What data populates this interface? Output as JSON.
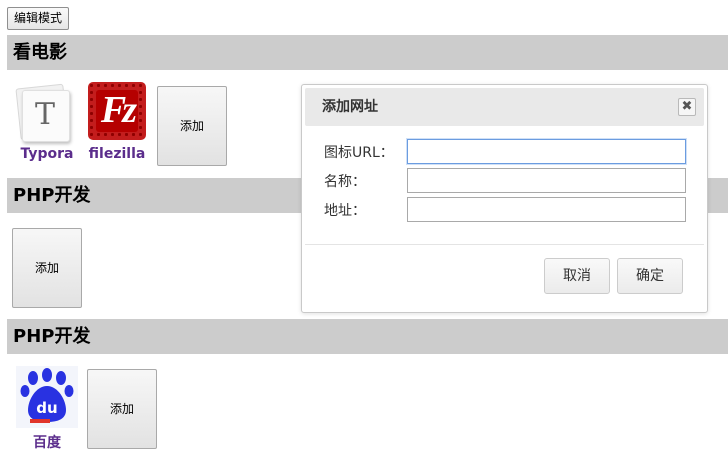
{
  "toolbar": {
    "edit_mode_label": "编辑模式"
  },
  "sections": [
    {
      "title": "看电影",
      "items": [
        {
          "label": "Typora",
          "icon": "typora-icon"
        },
        {
          "label": "filezilla",
          "icon": "filezilla-icon"
        }
      ],
      "add_label": "添加"
    },
    {
      "title": "PHP开发",
      "items": [],
      "add_label": "添加"
    },
    {
      "title": "PHP开发",
      "items": [
        {
          "label": "百度",
          "icon": "baidu-icon"
        }
      ],
      "add_label": "添加"
    }
  ],
  "dialog": {
    "title": "添加网址",
    "fields": [
      {
        "label": "图标URL：",
        "value": "",
        "placeholder": ""
      },
      {
        "label": "名称：",
        "value": "",
        "placeholder": ""
      },
      {
        "label": "地址：",
        "value": "",
        "placeholder": ""
      }
    ],
    "cancel_label": "取消",
    "confirm_label": "确定"
  },
  "icons": {
    "close": "close-icon"
  },
  "colors": {
    "section_header_bg": "#cccccc",
    "link_label": "#5b2d8c",
    "filezilla_red": "#c31d1d",
    "baidu_blue": "#2932e1"
  },
  "glyphs": {
    "typora": "T",
    "filezilla": "Fz",
    "close": "✖",
    "baidu": "du"
  }
}
